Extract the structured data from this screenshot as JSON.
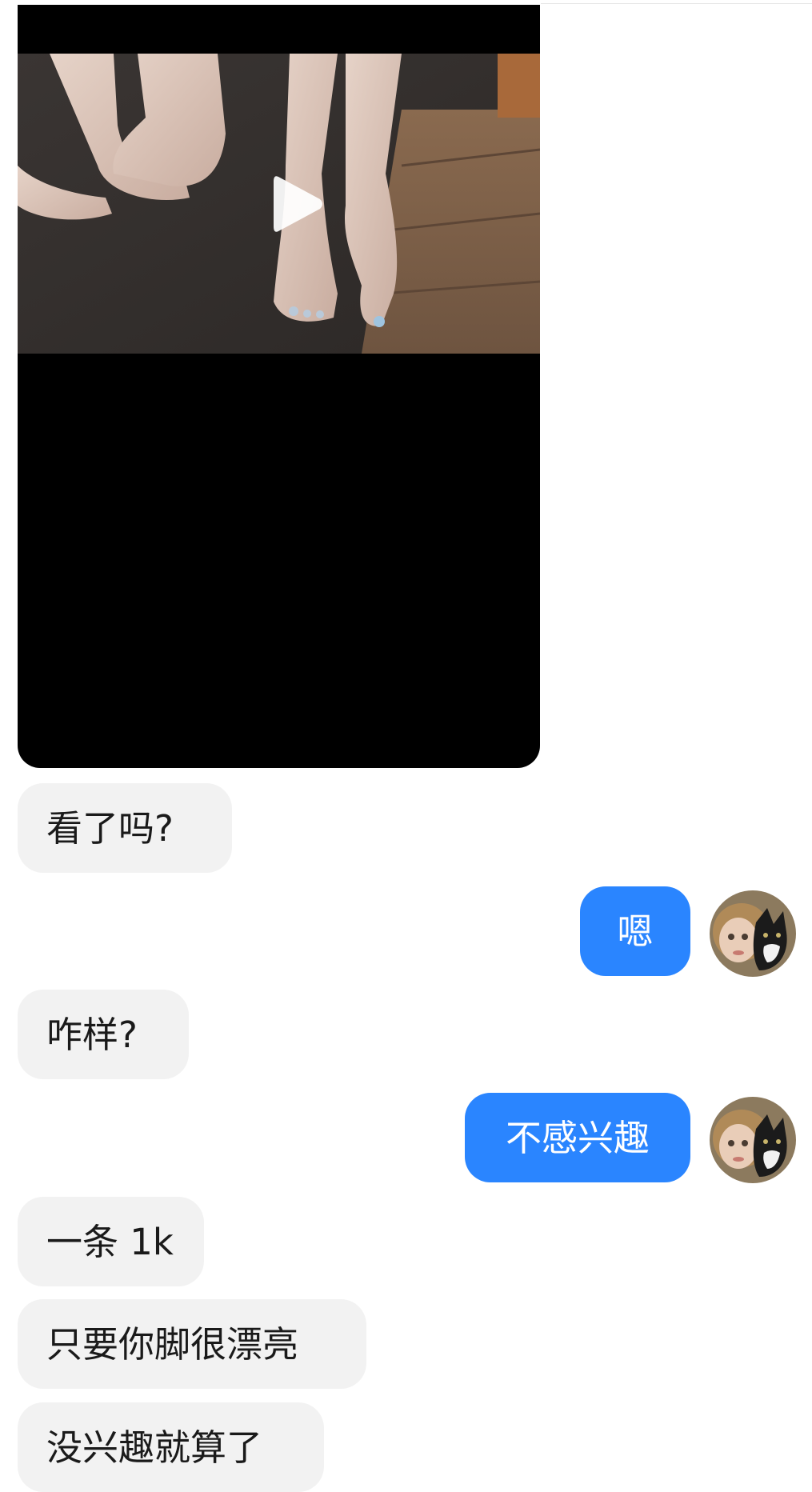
{
  "chat": {
    "video_message": {
      "icon": "play-icon"
    },
    "messages": [
      {
        "side": "incoming",
        "text": "看了吗?"
      },
      {
        "side": "outgoing",
        "text": "嗯"
      },
      {
        "side": "incoming",
        "text": "咋样?"
      },
      {
        "side": "outgoing",
        "text": "不感兴趣"
      },
      {
        "side": "incoming",
        "text": "一条 1k"
      },
      {
        "side": "incoming",
        "text": "只要你脚很漂亮"
      },
      {
        "side": "incoming",
        "text": "没兴趣就算了"
      }
    ]
  },
  "colors": {
    "outgoing_bubble": "#2a85ff",
    "incoming_bubble": "#f2f2f2",
    "background": "#ffffff",
    "video_background": "#000000"
  }
}
